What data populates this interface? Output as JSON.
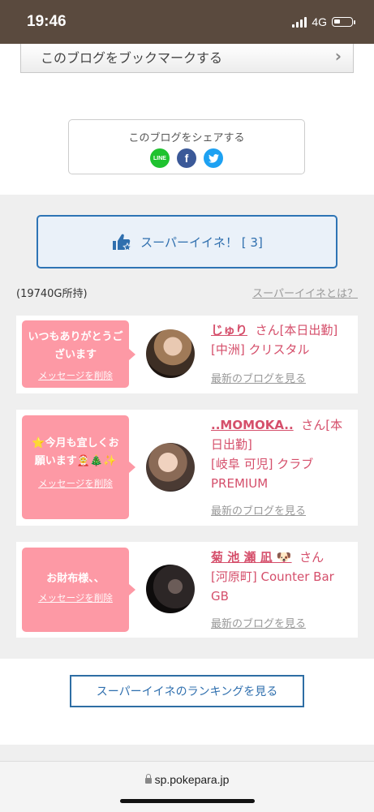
{
  "status": {
    "time": "19:46",
    "network": "4G"
  },
  "bookmark": {
    "label": "このブログをブックマークする"
  },
  "share": {
    "title": "このブログをシェアする",
    "line": "LINE",
    "facebook": "f",
    "twitter": "twitter-icon"
  },
  "super_like": {
    "label": "スーパーイイネ！ [ 3]"
  },
  "owned": "(19740G所持)",
  "what_is": "スーパーイイネとは？",
  "entries": [
    {
      "message": "いつもありがとうございます",
      "delete": "メッセージを削除",
      "name": "じゅり",
      "suffix": "さん[本日出勤]",
      "shop": "[中洲] クリスタル",
      "latest": "最新のブログを見る"
    },
    {
      "message": "⭐今月も宜しくお願います🤶🎄✨",
      "delete": "メッセージを削除",
      "name": "..MOMOKA..",
      "suffix": "さん[本日出勤]",
      "shop": "[岐阜 可児] クラブPREMIUM",
      "latest": "最新のブログを見る"
    },
    {
      "message": "お財布様、、",
      "delete": "メッセージを削除",
      "name": "菊 池 瀬 凪 🐶",
      "suffix": "さん",
      "shop": "[河原町] Counter Bar GB",
      "latest": "最新のブログを見る"
    }
  ],
  "ranking_button": "スーパーイイネのランキングを見る",
  "url": "sp.pokepara.jp"
}
